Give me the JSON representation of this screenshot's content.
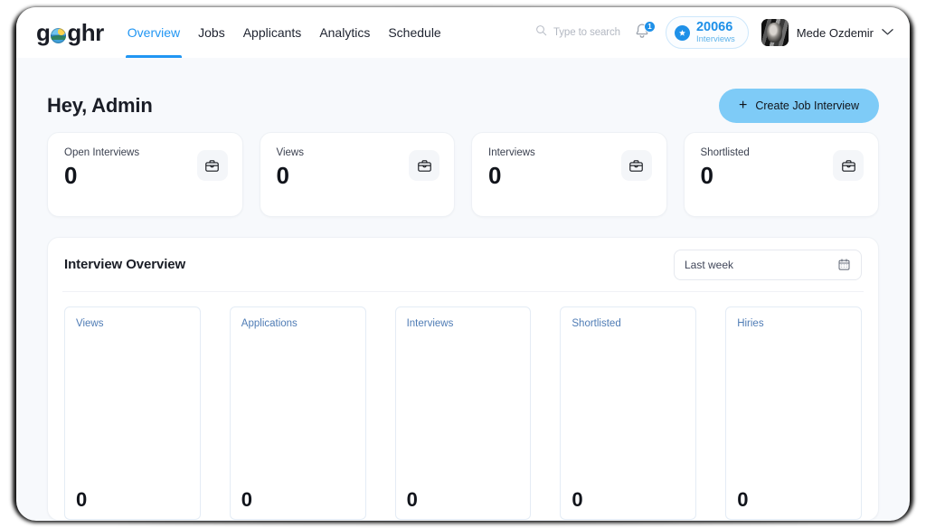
{
  "brand": {
    "name_before": "g",
    "globe": "globe-o",
    "name_after": "ghr"
  },
  "nav": {
    "items": [
      {
        "label": "Overview",
        "active": true
      },
      {
        "label": "Jobs",
        "active": false
      },
      {
        "label": "Applicants",
        "active": false
      },
      {
        "label": "Analytics",
        "active": false
      },
      {
        "label": "Schedule",
        "active": false
      }
    ]
  },
  "search": {
    "placeholder": "Type to search",
    "value": "",
    "icon": "search-icon"
  },
  "notifications": {
    "icon": "bell-icon",
    "count": "1"
  },
  "credits": {
    "icon": "star-coin-icon",
    "amount": "20066",
    "label": "Interviews"
  },
  "user": {
    "name": "Mede Ozdemir",
    "caret": "chevron-down-icon",
    "avatar": "user-avatar"
  },
  "header": {
    "greeting": "Hey, Admin",
    "cta_label": "Create Job Interview",
    "cta_icon": "plus-icon"
  },
  "stats": [
    {
      "label": "Open Interviews",
      "value": "0",
      "icon": "briefcase-icon"
    },
    {
      "label": "Views",
      "value": "0",
      "icon": "briefcase-icon"
    },
    {
      "label": "Interviews",
      "value": "0",
      "icon": "briefcase-icon"
    },
    {
      "label": "Shortlisted",
      "value": "0",
      "icon": "briefcase-icon"
    }
  ],
  "overview": {
    "title": "Interview Overview",
    "range": {
      "value": "Last week",
      "icon": "calendar-icon"
    }
  },
  "chart_data": {
    "type": "bar",
    "title": "Interview Overview",
    "subtitle": "Last week",
    "categories": [
      "Views",
      "Applications",
      "Interviews",
      "Shortlisted",
      "Hiries"
    ],
    "values": [
      0,
      0,
      0,
      0,
      0
    ],
    "value_labels": [
      "0",
      "0",
      "0",
      "0",
      "0"
    ],
    "xlabel": "",
    "ylabel": "",
    "ylim": [
      0,
      0
    ],
    "grid": false,
    "legend": "none",
    "note": "Funnel columns rendered as empty outlined bars; each bar label at top, count at bottom"
  },
  "colors": {
    "accent": "#2196f3",
    "cta": "#7ecbf7",
    "page_bg": "#f7f9fc",
    "card_bg": "#ffffff",
    "funnel_label": "#4f7cb5"
  }
}
